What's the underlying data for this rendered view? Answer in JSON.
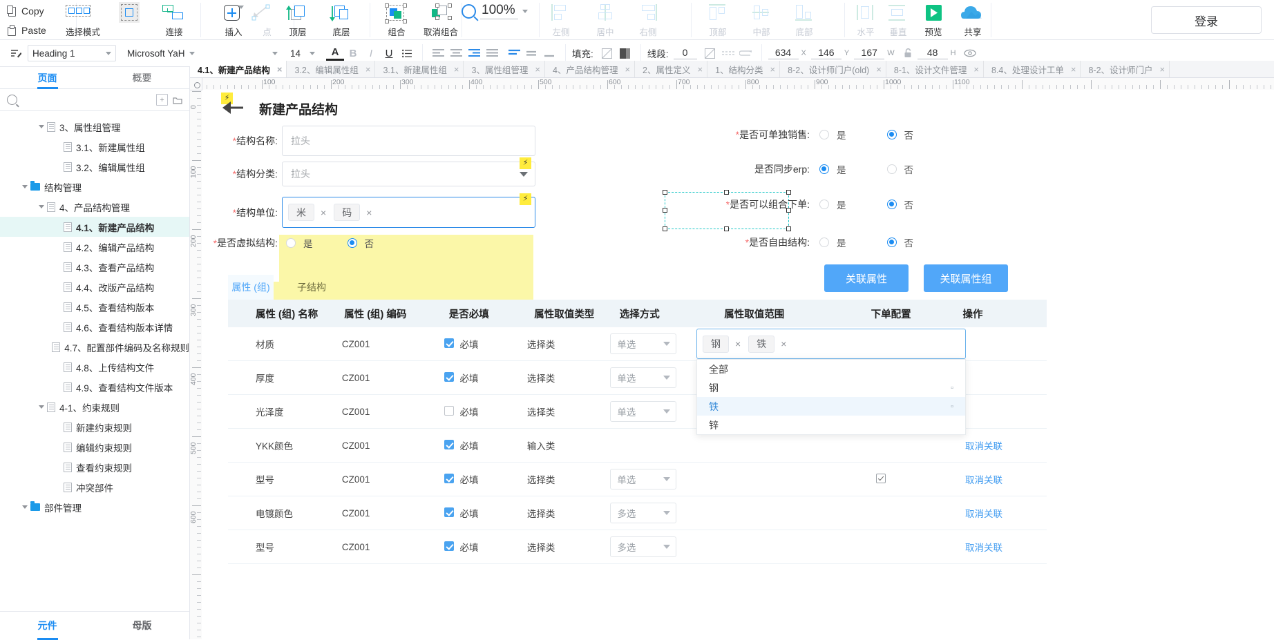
{
  "toolbar": {
    "clipboard": [
      {
        "label": "Copy",
        "icon": "copy-icon"
      },
      {
        "label": "Paste",
        "icon": "paste-icon"
      }
    ],
    "buttons": [
      {
        "label": "选择模式",
        "icon": "select-mode-icon",
        "dim": false
      },
      {
        "label": "连接",
        "icon": "connect-icon",
        "dim": false
      },
      {
        "label": "插入",
        "icon": "insert-icon",
        "dim": false
      },
      {
        "label": "点",
        "icon": "point-icon",
        "dim": true
      },
      {
        "label": "顶层",
        "icon": "bring-to-front-icon",
        "dim": false
      },
      {
        "label": "底层",
        "icon": "send-to-back-icon",
        "dim": false
      },
      {
        "label": "组合",
        "icon": "group-icon",
        "dim": false
      },
      {
        "label": "取消组合",
        "icon": "ungroup-icon",
        "dim": false
      },
      {
        "label": "左侧",
        "icon": "align-left-icon",
        "dim": true
      },
      {
        "label": "居中",
        "icon": "align-center-icon",
        "dim": true
      },
      {
        "label": "右侧",
        "icon": "align-right-icon",
        "dim": true
      },
      {
        "label": "顶部",
        "icon": "align-top-icon",
        "dim": true
      },
      {
        "label": "中部",
        "icon": "align-middle-icon",
        "dim": true
      },
      {
        "label": "底部",
        "icon": "align-bottom-icon",
        "dim": true
      },
      {
        "label": "水平",
        "icon": "distribute-horizontal-icon",
        "dim": true
      },
      {
        "label": "垂直",
        "icon": "distribute-vertical-icon",
        "dim": true
      },
      {
        "label": "预览",
        "icon": "preview-play-icon",
        "dim": false
      },
      {
        "label": "共享",
        "icon": "share-cloud-icon",
        "dim": false
      }
    ],
    "zoom": "100%",
    "login": "登录"
  },
  "format_bar": {
    "style": "Heading 1",
    "font": "Microsoft YaH",
    "font_variant": "",
    "size": "14",
    "fill_label": "填充:",
    "line_label": "线段:",
    "line_width": "0",
    "x": "634",
    "x_label": "X",
    "y": "146",
    "y_label": "Y",
    "w": "167",
    "w_label": "W",
    "h": "48",
    "h_label": "H"
  },
  "file_tabs": [
    {
      "label": "4.1、新建产品结构",
      "active": true
    },
    {
      "label": "3.2、编辑属性组",
      "active": false
    },
    {
      "label": "3.1、新建属性组",
      "active": false
    },
    {
      "label": "3、属性组管理",
      "active": false
    },
    {
      "label": "4、产品结构管理",
      "active": false
    },
    {
      "label": "2、属性定义",
      "active": false
    },
    {
      "label": "1、结构分类",
      "active": false
    },
    {
      "label": "8-2、设计师门户(old)",
      "active": false
    },
    {
      "label": "8-1、设计文件管理",
      "active": false
    },
    {
      "label": "8.4、处理设计工单",
      "active": false
    },
    {
      "label": "8-2、设计师门户",
      "active": false
    }
  ],
  "left_panel": {
    "tabs": [
      {
        "label": "页面",
        "active": true
      },
      {
        "label": "概要",
        "active": false
      }
    ],
    "search_placeholder": "",
    "tree": [
      {
        "label": "3、属性组管理",
        "indent": 1,
        "arrow": true,
        "icon": "page-icon",
        "selected": false
      },
      {
        "label": "3.1、新建属性组",
        "indent": 2,
        "arrow": false,
        "icon": "page-icon",
        "selected": false
      },
      {
        "label": "3.2、编辑属性组",
        "indent": 2,
        "arrow": false,
        "icon": "page-icon",
        "selected": false
      },
      {
        "label": "结构管理",
        "indent": 0,
        "arrow": true,
        "icon": "folder-icon",
        "selected": false
      },
      {
        "label": "4、产品结构管理",
        "indent": 1,
        "arrow": true,
        "icon": "page-icon",
        "selected": false
      },
      {
        "label": "4.1、新建产品结构",
        "indent": 2,
        "arrow": false,
        "icon": "page-icon",
        "selected": true
      },
      {
        "label": "4.2、编辑产品结构",
        "indent": 2,
        "arrow": false,
        "icon": "page-icon",
        "selected": false
      },
      {
        "label": "4.3、查看产品结构",
        "indent": 2,
        "arrow": false,
        "icon": "page-icon",
        "selected": false
      },
      {
        "label": "4.4、改版产品结构",
        "indent": 2,
        "arrow": false,
        "icon": "page-icon",
        "selected": false
      },
      {
        "label": "4.5、查看结构版本",
        "indent": 2,
        "arrow": false,
        "icon": "page-icon",
        "selected": false
      },
      {
        "label": "4.6、查看结构版本详情",
        "indent": 2,
        "arrow": false,
        "icon": "page-icon",
        "selected": false
      },
      {
        "label": "4.7、配置部件编码及名称规则",
        "indent": 2,
        "arrow": false,
        "icon": "page-icon",
        "selected": false
      },
      {
        "label": "4.8、上传结构文件",
        "indent": 2,
        "arrow": false,
        "icon": "page-icon",
        "selected": false
      },
      {
        "label": "4.9、查看结构文件版本",
        "indent": 2,
        "arrow": false,
        "icon": "page-icon",
        "selected": false
      },
      {
        "label": "4-1、约束规则",
        "indent": 1,
        "arrow": true,
        "icon": "page-icon",
        "selected": false
      },
      {
        "label": "新建约束规则",
        "indent": 2,
        "arrow": false,
        "icon": "page-icon",
        "selected": false
      },
      {
        "label": "编辑约束规则",
        "indent": 2,
        "arrow": false,
        "icon": "page-icon",
        "selected": false
      },
      {
        "label": "查看约束规则",
        "indent": 2,
        "arrow": false,
        "icon": "page-icon",
        "selected": false
      },
      {
        "label": "冲突部件",
        "indent": 2,
        "arrow": false,
        "icon": "page-icon",
        "selected": false
      },
      {
        "label": "部件管理",
        "indent": 0,
        "arrow": true,
        "icon": "folder-icon",
        "selected": false
      }
    ],
    "bottom_tabs": [
      {
        "label": "元件",
        "active": true
      },
      {
        "label": "母版",
        "active": false
      }
    ]
  },
  "rulers": {
    "h_numbers": [
      "0",
      "100",
      "200",
      "300",
      "400",
      "500",
      "600",
      "700",
      "800",
      "900",
      "1000",
      "1100"
    ],
    "v_numbers": [
      "0",
      "100",
      "200",
      "300",
      "400",
      "500",
      "600"
    ]
  },
  "canvas": {
    "page_title": "新建产品结构",
    "form": {
      "left_fields": [
        {
          "label": "结构名称:",
          "required": true,
          "value": "拉头",
          "type": "input"
        },
        {
          "label": "结构分类:",
          "required": true,
          "value": "拉头",
          "type": "select"
        },
        {
          "label": "结构单位:",
          "required": true,
          "tags": [
            "米",
            "码"
          ],
          "type": "tags"
        }
      ],
      "virtual_structure": {
        "label": "是否虚拟结构:",
        "required": true,
        "yes": "是",
        "no": "否",
        "selected": "否"
      },
      "right_fields": [
        {
          "label": "是否可单独销售:",
          "required": true,
          "yes": "是",
          "no": "否",
          "selected": "否"
        },
        {
          "label": "是否同步erp:",
          "required": false,
          "yes": "是",
          "no": "否",
          "selected": "是"
        },
        {
          "label": "是否可以组合下单:",
          "required": true,
          "yes": "是",
          "no": "否",
          "selected": "否"
        },
        {
          "label": "是否自由结构:",
          "required": true,
          "yes": "是",
          "no": "否",
          "selected": "否"
        }
      ]
    },
    "action_buttons": [
      {
        "label": "关联属性"
      },
      {
        "label": "关联属性组"
      }
    ],
    "inner_tabs": [
      {
        "label": "属性 (组)",
        "selected": true
      },
      {
        "label": "子结构",
        "selected": false
      }
    ],
    "table": {
      "headers": [
        "属性 (组) 名称",
        "属性 (组) 编码",
        "是否必填",
        "属性取值类型",
        "选择方式",
        "属性取值范围",
        "下单配置",
        "操作"
      ],
      "rows": [
        {
          "name": "材质",
          "code": "CZ001",
          "required_label": "必填",
          "required": true,
          "type": "选择类",
          "mode": "单选",
          "range": "",
          "order_cfg": false,
          "action": ""
        },
        {
          "name": "厚度",
          "code": "CZ001",
          "required_label": "必填",
          "required": true,
          "type": "选择类",
          "mode": "单选",
          "range": "",
          "order_cfg": false,
          "action": ""
        },
        {
          "name": "光泽度",
          "code": "CZ001",
          "required_label": "必填",
          "required": false,
          "type": "选择类",
          "mode": "单选",
          "range": "",
          "order_cfg": false,
          "action": ""
        },
        {
          "name": "YKK颜色",
          "code": "CZ001",
          "required_label": "必填",
          "required": true,
          "type": "输入类",
          "mode": "",
          "range": "",
          "order_cfg": false,
          "action": "取消关联"
        },
        {
          "name": "型号",
          "code": "CZ001",
          "required_label": "必填",
          "required": true,
          "type": "选择类",
          "mode": "单选",
          "range": "",
          "order_cfg": true,
          "action": "取消关联"
        },
        {
          "name": "电镀颜色",
          "code": "CZ001",
          "required_label": "必填",
          "required": true,
          "type": "选择类",
          "mode": "多选",
          "range": "",
          "order_cfg": false,
          "action": "取消关联"
        },
        {
          "name": "型号",
          "code": "CZ001",
          "required_label": "必填",
          "required": true,
          "type": "选择类",
          "mode": "多选",
          "range": "",
          "order_cfg": false,
          "action": "取消关联"
        }
      ]
    },
    "dropdown": {
      "tags": [
        "钢",
        "铁"
      ],
      "options": [
        {
          "label": "全部",
          "highlight": false,
          "mark": ""
        },
        {
          "label": "钢",
          "highlight": false,
          "mark": "▫"
        },
        {
          "label": "铁",
          "highlight": true,
          "mark": "▫"
        },
        {
          "label": "锌",
          "highlight": false,
          "mark": ""
        }
      ]
    }
  },
  "colors": {
    "accent": "#1b8cf2",
    "button_blue": "#51a7f9",
    "selection_teal": "#1ec7c7",
    "highlight_yellow": "#fbf7a8",
    "tree_selected": "#e6f7f6"
  }
}
